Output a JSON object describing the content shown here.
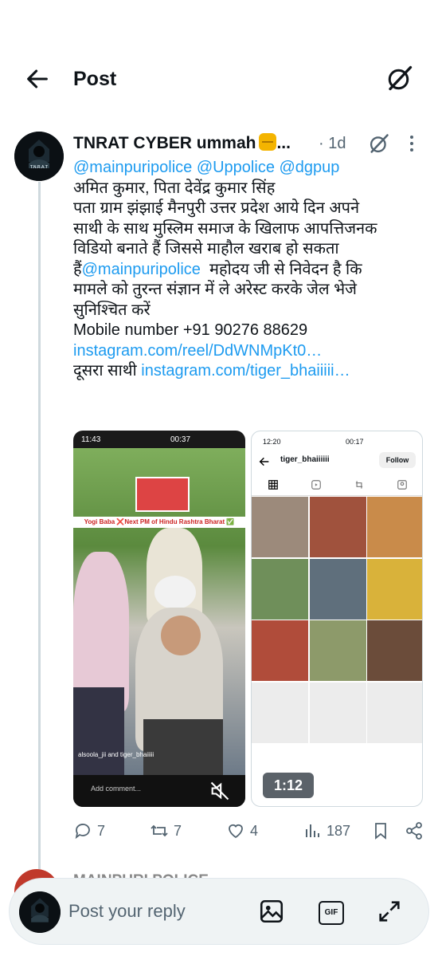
{
  "header": {
    "title": "Post"
  },
  "post": {
    "author": "TNRAT CYBER ummah",
    "author_suffix": "...",
    "time": "· 1d",
    "avatar_text": "T.N.R.A.T",
    "mentions": "@mainpuripolice @Uppolice @dgpup",
    "lines": [
      "अमित कुमार, पिता देवेंद्र कुमार सिंह",
      "पता ग्राम झंझाई मैनपुरी उत्तर प्रदेश आये दिन अपने",
      "साथी के साथ मुस्लिम समाज के खिलाफ आपत्तिजनक",
      "विडियो बनाते हैं जिससे माहौल खराब हो सकता",
      "मामले को तुरन्त संज्ञान में ले अरेस्ट करके जेल भेजे",
      "सुनिश्चित करें",
      "Mobile number +91 90276 88629"
    ],
    "line5_prefix": "हैं",
    "line5_mention": "@mainpuripolice",
    "line5_suffix": "  महोदय जी से निवेदन है कि",
    "link1": "instagram.com/reel/DdWNMpKt0…",
    "second_prefix": "दूसरा साथी ",
    "link2": "instagram.com/tiger_bhaiiiii…"
  },
  "media1": {
    "status_time": "11:43",
    "status_time2": "00:37",
    "banner": "Yogi Baba ❌Next PM of Hindu Rashtra Bharat ✅",
    "caption": "alsoola_jii and tiger_bhaiiiii",
    "comment_placeholder": "Add comment..."
  },
  "media2": {
    "status_time": "12:20",
    "status_time2": "00:17",
    "username": "tiger_bhaiiiiii",
    "follow_label": "Follow",
    "duration": "1:12"
  },
  "actions": {
    "replies": "7",
    "reposts": "7",
    "likes": "4",
    "views": "187"
  },
  "next_post": {
    "author": "MAINPURI POLICE"
  },
  "reply_bar": {
    "placeholder": "Post your reply",
    "gif_label": "GIF"
  },
  "colors": {
    "link": "#1d9bf0",
    "muted": "#536471",
    "text": "#0f1419"
  }
}
